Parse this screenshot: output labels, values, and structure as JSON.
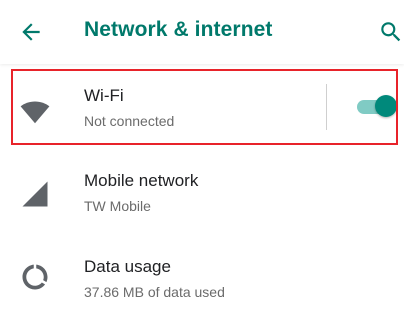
{
  "appbar": {
    "title": "Network & internet",
    "back_icon": "arrow-back-icon",
    "search_icon": "search-icon",
    "accent_color": "#00796b"
  },
  "settings": {
    "wifi": {
      "label": "Wi-Fi",
      "status": "Not connected",
      "icon": "wifi-icon",
      "toggle_on": true,
      "toggle_color": "#00897b",
      "highlight_color": "#e8232a"
    },
    "mobile": {
      "label": "Mobile network",
      "status": "TW Mobile",
      "icon": "signal-icon"
    },
    "data": {
      "label": "Data usage",
      "status": "37.86 MB of data used",
      "icon": "data-usage-icon"
    }
  }
}
